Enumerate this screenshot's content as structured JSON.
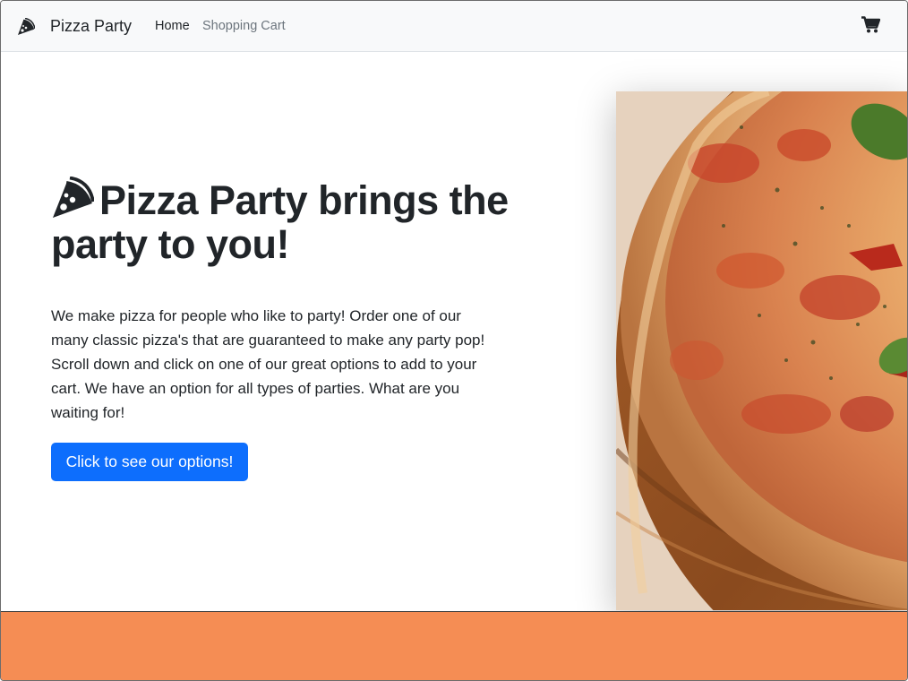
{
  "navbar": {
    "brand": "Pizza Party",
    "links": [
      {
        "label": "Home"
      },
      {
        "label": "Shopping Cart"
      }
    ]
  },
  "hero": {
    "title_strong": "Pizza Party",
    "title_rest": " brings the party to you!",
    "description": "We make pizza for people who like to party! Order one of our many classic pizza's that are guaranteed to make any party pop! Scroll down and click on one of our great options to add to your cart. We have an option for all types of parties. What are you waiting for!",
    "cta_label": "Click to see our options!"
  },
  "icons": {
    "brand": "pizza-slice-icon",
    "cart": "shopping-cart-icon",
    "hero": "pizza-slice-icon"
  },
  "colors": {
    "accent": "#0d6efd",
    "band": "#f58d54",
    "navbar_bg": "#f8f9fa",
    "text": "#212529",
    "muted": "#6c757d"
  }
}
